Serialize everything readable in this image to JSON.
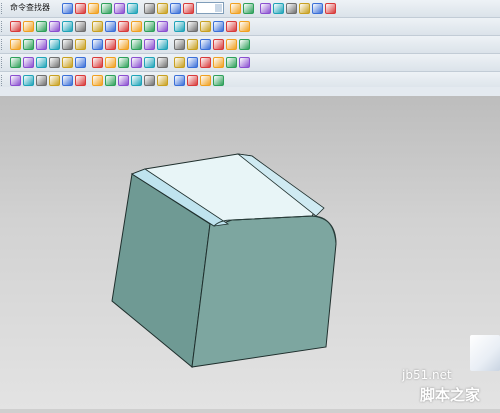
{
  "window": {
    "search_label": "命令查找器"
  },
  "toolbar": {
    "row_icons": [
      [
        "search-icon",
        "open-icon",
        "undo-icon",
        "cube-icon",
        "shaded-icon",
        "wireframe-icon",
        "render-icon",
        "view-front-icon",
        "view-top-icon",
        "filter-icon",
        "fit-icon",
        "layer-icon",
        "snap-icon",
        "point-icon",
        "measure-icon",
        "settings-icon",
        "info-icon",
        "help-icon"
      ],
      [
        "sketch-icon",
        "line-icon",
        "arc-icon",
        "circle-icon",
        "rect-icon",
        "polygon-icon",
        "text-icon",
        "spline-icon",
        "mirror-icon",
        "offset-icon",
        "trim-icon",
        "extend-icon",
        "fillet-icon",
        "chamfer-icon",
        "pattern-icon",
        "project-icon",
        "intersect-icon",
        "dimension-icon"
      ],
      [
        "extrude-icon",
        "revolve-icon",
        "sweep-icon",
        "loft-icon",
        "shell-icon",
        "hole-icon",
        "boss-icon",
        "pocket-icon",
        "rib-icon",
        "draft-icon",
        "blend-icon",
        "face-icon",
        "edge-icon",
        "sew-icon",
        "thicken-icon",
        "split-icon",
        "unite-icon",
        "subtract-icon"
      ],
      [
        "surface-icon",
        "mesh-icon",
        "curve-icon",
        "bridge-icon",
        "blend-curve-icon",
        "offset-curve-icon",
        "project-curve-icon",
        "isoparam-icon",
        "trim-surface-icon",
        "extend-surface-icon",
        "patch-icon",
        "ruled-icon",
        "swept-icon",
        "through-curves-icon",
        "n-sided-icon",
        "law-icon",
        "analysis-icon",
        "section-icon"
      ],
      [
        "select-icon",
        "snap-end-icon",
        "snap-mid-icon",
        "snap-center-icon",
        "snap-quad-icon",
        "snap-intersect-icon",
        "snap-tangent-icon",
        "snap-perp-icon",
        "snap-point-icon",
        "filter-face-icon",
        "filter-edge-icon",
        "filter-body-icon",
        "csys-icon",
        "wcs-icon",
        "grid-icon",
        "triad-icon"
      ]
    ]
  },
  "model": {
    "description_colors": {
      "top_face": "#e8f5f7",
      "side_faces": "#7da6a0",
      "edge": "#1f2f2d"
    }
  },
  "watermark": {
    "site": "jb51.net",
    "brand": "脚本之家"
  }
}
